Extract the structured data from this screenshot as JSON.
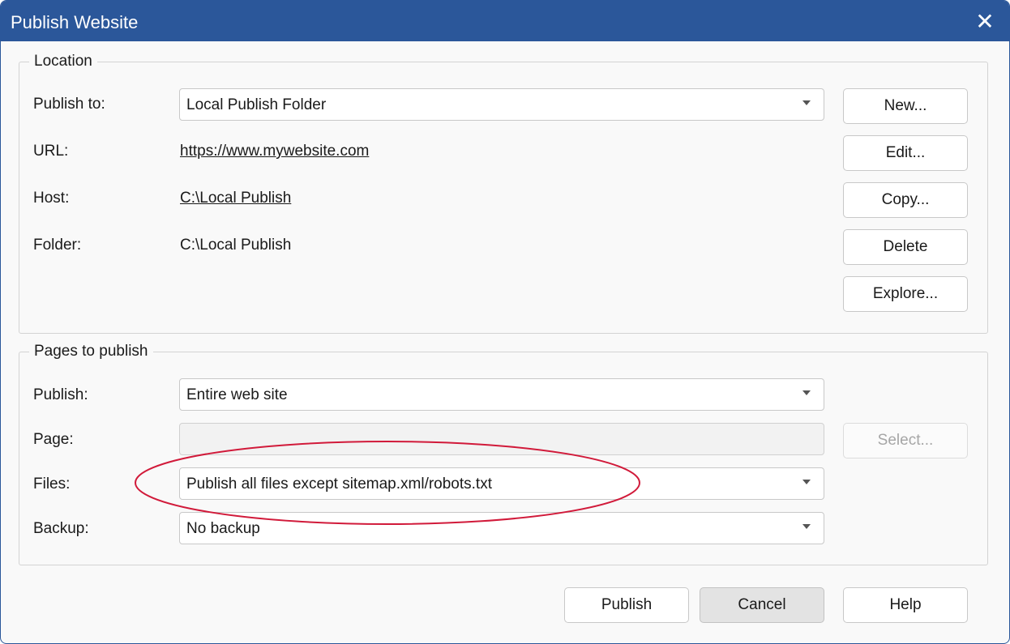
{
  "window": {
    "title": "Publish Website"
  },
  "location": {
    "legend": "Location",
    "publish_to_label": "Publish to:",
    "publish_to_value": "Local Publish Folder",
    "url_label": "URL:",
    "url_value": "https://www.mywebsite.com",
    "host_label": "Host:",
    "host_value": "C:\\Local Publish",
    "folder_label": "Folder:",
    "folder_value": "C:\\Local Publish",
    "buttons": {
      "new": "New...",
      "edit": "Edit...",
      "copy": "Copy...",
      "delete": "Delete",
      "explore": "Explore..."
    }
  },
  "pages": {
    "legend": "Pages to publish",
    "publish_label": "Publish:",
    "publish_value": "Entire web site",
    "page_label": "Page:",
    "page_value": "",
    "select_button": "Select...",
    "files_label": "Files:",
    "files_value": "Publish all files except sitemap.xml/robots.txt",
    "backup_label": "Backup:",
    "backup_value": "No backup"
  },
  "footer": {
    "publish": "Publish",
    "cancel": "Cancel",
    "help": "Help"
  },
  "colors": {
    "titlebar": "#2b579a",
    "annotation": "#d11a3a"
  }
}
